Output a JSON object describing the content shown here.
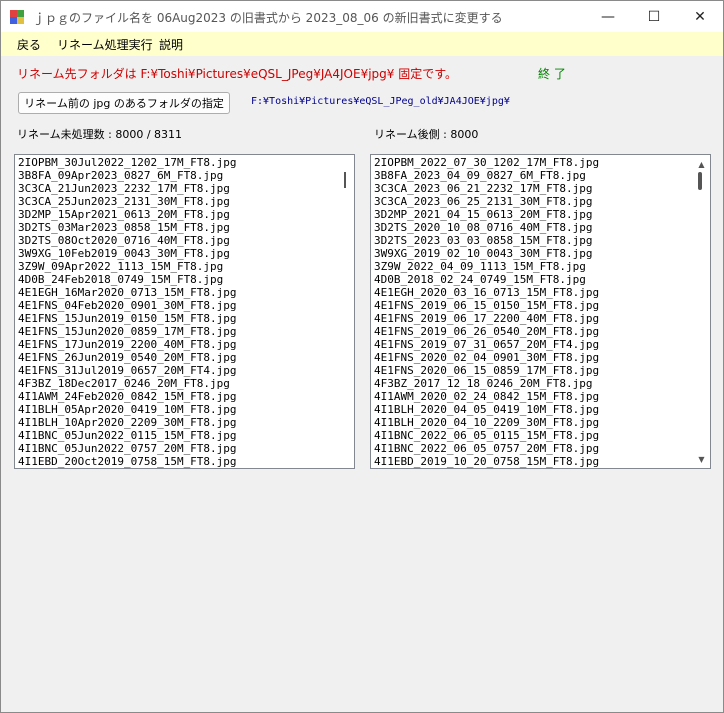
{
  "window": {
    "title": "ｊｐｇのファイル名を 06Aug2023 の旧書式から 2023_08_06 の新旧書式に変更する",
    "controls": {
      "minimize": "—",
      "maximize": "☐",
      "close": "✕"
    }
  },
  "menu": {
    "back": "戻る",
    "run": "リネーム処理実行",
    "help": "説明"
  },
  "destination_label": "リネーム先フォルダは F:¥Toshi¥Pictures¥eQSL_JPeg¥JA4JOE¥jpg¥ 固定です。",
  "end_label": "終 了",
  "source_button": "リネーム前の jpg のあるフォルダの指定",
  "source_path": "F:¥Toshi¥Pictures¥eQSL_JPeg_old¥JA4JOE¥jpg¥",
  "unprocessed_count_label": "リネーム未処理数 : 8000 / 8311",
  "renamed_count_label": "リネーム後側 : 8000",
  "left_list": [
    "2IOPBM_30Jul2022_1202_17M_FT8.jpg",
    "3B8FA_09Apr2023_0827_6M_FT8.jpg",
    "3C3CA_21Jun2023_2232_17M_FT8.jpg",
    "3C3CA_25Jun2023_2131_30M_FT8.jpg",
    "3D2MP_15Apr2021_0613_20M_FT8.jpg",
    "3D2TS_03Mar2023_0858_15M_FT8.jpg",
    "3D2TS_08Oct2020_0716_40M_FT8.jpg",
    "3W9XG_10Feb2019_0043_30M_FT8.jpg",
    "3Z9W_09Apr2022_1113_15M_FT8.jpg",
    "4D0B_24Feb2018_0749_15M_FT8.jpg",
    "4E1EGH_16Mar2020_0713_15M_FT8.jpg",
    "4E1FNS_04Feb2020_0901_30M_FT8.jpg",
    "4E1FNS_15Jun2019_0150_15M_FT8.jpg",
    "4E1FNS_15Jun2020_0859_17M_FT8.jpg",
    "4E1FNS_17Jun2019_2200_40M_FT8.jpg",
    "4E1FNS_26Jun2019_0540_20M_FT8.jpg",
    "4E1FNS_31Jul2019_0657_20M_FT4.jpg",
    "4F3BZ_18Dec2017_0246_20M_FT8.jpg",
    "4I1AWM_24Feb2020_0842_15M_FT8.jpg",
    "4I1BLH_05Apr2020_0419_10M_FT8.jpg",
    "4I1BLH_10Apr2020_2209_30M_FT8.jpg",
    "4I1BNC_05Jun2022_0115_15M_FT8.jpg",
    "4I1BNC_05Jun2022_0757_20M_FT8.jpg",
    "4I1EBD_20Oct2019_0758_15M_FT8.jpg"
  ],
  "right_list": [
    "2IOPBM_2022_07_30_1202_17M_FT8.jpg",
    "3B8FA_2023_04_09_0827_6M_FT8.jpg",
    "3C3CA_2023_06_21_2232_17M_FT8.jpg",
    "3C3CA_2023_06_25_2131_30M_FT8.jpg",
    "3D2MP_2021_04_15_0613_20M_FT8.jpg",
    "3D2TS_2020_10_08_0716_40M_FT8.jpg",
    "3D2TS_2023_03_03_0858_15M_FT8.jpg",
    "3W9XG_2019_02_10_0043_30M_FT8.jpg",
    "3Z9W_2022_04_09_1113_15M_FT8.jpg",
    "4D0B_2018_02_24_0749_15M_FT8.jpg",
    "4E1EGH_2020_03_16_0713_15M_FT8.jpg",
    "4E1FNS_2019_06_15_0150_15M_FT8.jpg",
    "4E1FNS_2019_06_17_2200_40M_FT8.jpg",
    "4E1FNS_2019_06_26_0540_20M_FT8.jpg",
    "4E1FNS_2019_07_31_0657_20M_FT4.jpg",
    "4E1FNS_2020_02_04_0901_30M_FT8.jpg",
    "4E1FNS_2020_06_15_0859_17M_FT8.jpg",
    "4F3BZ_2017_12_18_0246_20M_FT8.jpg",
    "4I1AWM_2020_02_24_0842_15M_FT8.jpg",
    "4I1BLH_2020_04_05_0419_10M_FT8.jpg",
    "4I1BLH_2020_04_10_2209_30M_FT8.jpg",
    "4I1BNC_2022_06_05_0115_15M_FT8.jpg",
    "4I1BNC_2022_06_05_0757_20M_FT8.jpg",
    "4I1EBD_2019_10_20_0758_15M_FT8.jpg"
  ],
  "colors": {
    "menubar": "#ffffcc",
    "destination_text": "#cc0000",
    "end_text": "#008000",
    "path_text": "#00008b"
  }
}
